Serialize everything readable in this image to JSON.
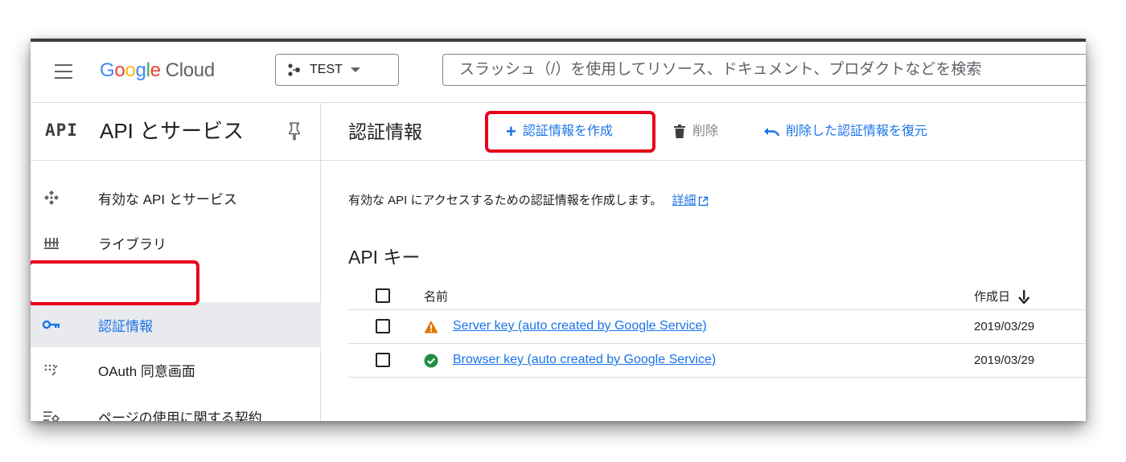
{
  "header": {
    "logo_google_letters": [
      "G",
      "o",
      "o",
      "g",
      "l",
      "e"
    ],
    "logo_product": "Cloud",
    "project_name": "TEST",
    "search_placeholder": "スラッシュ（/）を使用してリソース、ドキュメント、プロダクトなどを検索"
  },
  "sidebar": {
    "badge": "API",
    "title": "API とサービス",
    "items": [
      {
        "label": "有効な API とサービス",
        "icon": "hub-icon",
        "active": false
      },
      {
        "label": "ライブラリ",
        "icon": "library-icon",
        "active": false
      },
      {
        "label": "認証情報",
        "icon": "key-icon",
        "active": true
      },
      {
        "label": "OAuth 同意画面",
        "icon": "oauth-consent-icon",
        "active": false
      },
      {
        "label": "ページの使用に関する契約",
        "icon": "page-settings-icon",
        "active": false
      }
    ]
  },
  "toolbar": {
    "title": "認証情報",
    "create_label": "認証情報を作成",
    "delete_label": "削除",
    "restore_label": "削除した認証情報を復元"
  },
  "main": {
    "description": "有効な API にアクセスするための認証情報を作成します。",
    "details_link": "詳細",
    "section_title": "API キー",
    "table": {
      "columns": [
        "名前",
        "作成日"
      ],
      "rows": [
        {
          "status": "warning",
          "name": "Server key (auto created by Google Service)",
          "date": "2019/03/29"
        },
        {
          "status": "ok",
          "name": "Browser key (auto created by Google Service)",
          "date": "2019/03/29"
        }
      ]
    }
  },
  "colors": {
    "accent": "#1a73e8",
    "highlight": "#e8001c",
    "warning": "#e37400",
    "success": "#1e8e3e",
    "active_bg": "#e8eaed"
  }
}
